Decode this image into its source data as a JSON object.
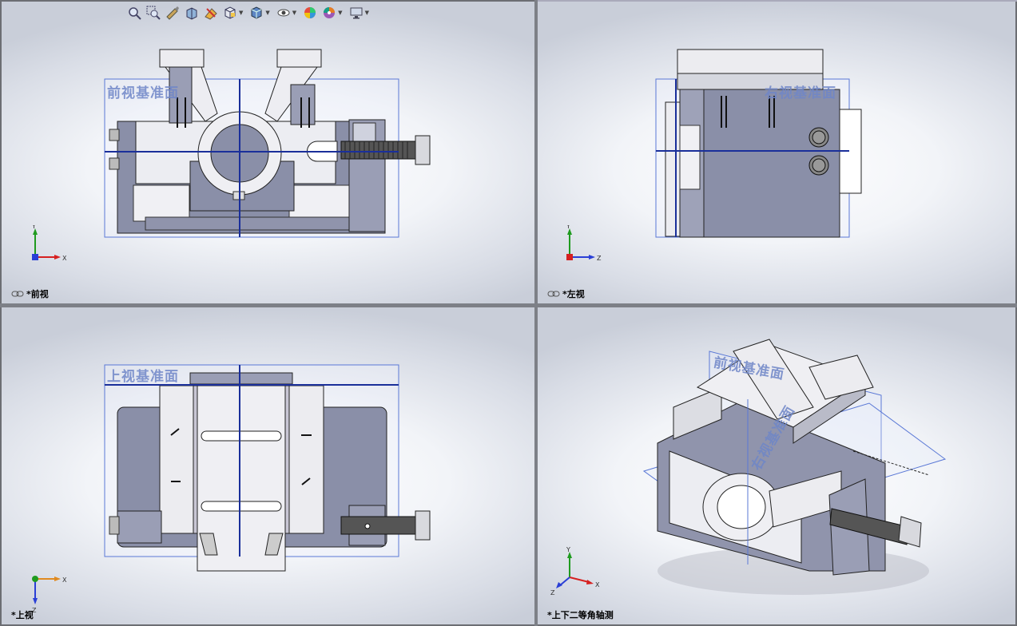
{
  "toolbar": {
    "items": [
      {
        "name": "zoom-to-fit-icon"
      },
      {
        "name": "zoom-to-area-icon"
      },
      {
        "name": "previous-view-icon"
      },
      {
        "name": "section-view-icon"
      },
      {
        "name": "dynamic-annotation-icon"
      },
      {
        "name": "view-orientation-icon",
        "dropdown": true
      },
      {
        "name": "display-style-icon",
        "dropdown": true
      },
      {
        "name": "hide-show-items-icon",
        "dropdown": true
      },
      {
        "name": "edit-appearance-icon"
      },
      {
        "name": "apply-scene-icon",
        "dropdown": true
      },
      {
        "name": "view-settings-icon",
        "dropdown": true
      }
    ]
  },
  "viewports": {
    "front": {
      "label": "*前视",
      "plane": "前视基准面",
      "triad": {
        "a": "Y",
        "b": "X"
      }
    },
    "left": {
      "label": "*左视",
      "plane": "右视基准面",
      "triad": {
        "a": "Y",
        "b": "Z"
      }
    },
    "top": {
      "label": "*上视",
      "plane": "上视基准面",
      "triad": {
        "a": "X",
        "b": "Z"
      }
    },
    "iso": {
      "label": "*上下二等角轴测",
      "plane1": "前视基准面",
      "plane2": "右视基准面",
      "triad": {
        "a": "Y",
        "b": "X",
        "c": "Z"
      }
    }
  },
  "colors": {
    "plane": "#5a78d6",
    "axis": "#1a2f9a",
    "part_dark": "#8a8fa8",
    "part_light": "#e8e8ee",
    "triad_x": "#d62020",
    "triad_y": "#1f9b1f",
    "triad_z": "#2a3fd6"
  }
}
